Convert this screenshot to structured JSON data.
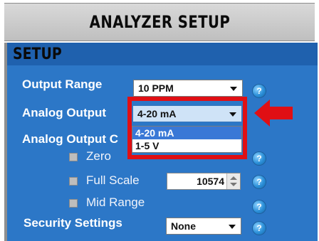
{
  "header": {
    "title": "ANALYZER SETUP"
  },
  "section": {
    "title": "SETUP"
  },
  "rows": {
    "output_range": {
      "label": "Output Range",
      "value": "10 PPM"
    },
    "analog_output": {
      "label": "Analog Output",
      "value": "4-20 mA",
      "options": [
        "4-20 mA",
        "1-5 V"
      ]
    },
    "analog_output_cal": {
      "label": "Analog Output C"
    },
    "zero": {
      "label": "Zero"
    },
    "full_scale": {
      "label": "Full Scale",
      "value": "10574"
    },
    "mid_range": {
      "label": "Mid Range"
    },
    "security": {
      "label": "Security Settings",
      "value": "None"
    }
  },
  "help_glyph": "?",
  "colors": {
    "panel_blue": "#2c77c7",
    "highlight_red": "#e00f14",
    "header_gray": "#c9c9c9"
  },
  "icons": [
    "help-icon",
    "dropdown-arrow-icon",
    "red-arrow-icon",
    "spin-up-icon",
    "spin-down-icon"
  ]
}
